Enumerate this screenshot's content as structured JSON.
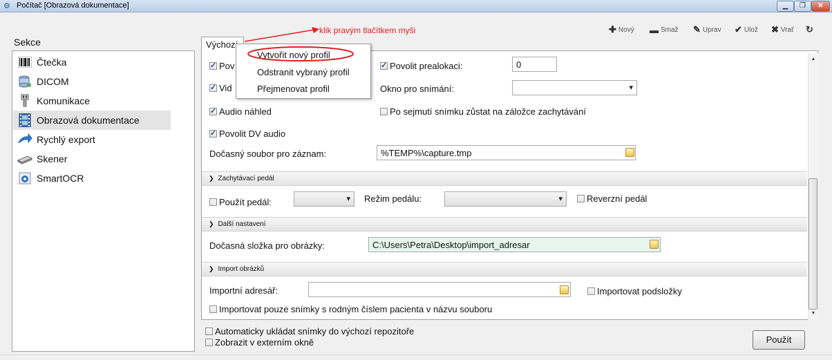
{
  "window": {
    "title": "Počítač [Obrazová dokumentace]"
  },
  "sidebar": {
    "heading": "Sekce",
    "items": [
      {
        "label": "Čtečka",
        "icon": "barcode-icon"
      },
      {
        "label": "DICOM",
        "icon": "database-icon"
      },
      {
        "label": "Komunikace",
        "icon": "connector-icon"
      },
      {
        "label": "Obrazová dokumentace",
        "icon": "film-icon",
        "selected": true
      },
      {
        "label": "Rychlý export",
        "icon": "export-arrow-icon"
      },
      {
        "label": "Skener",
        "icon": "scanner-icon"
      },
      {
        "label": "SmartOCR",
        "icon": "ocr-icon"
      }
    ]
  },
  "toolbar": {
    "new": "Nový",
    "delete": "Smaž",
    "edit": "Uprav",
    "save": "Ulož",
    "revert": "Vrať"
  },
  "tabs": {
    "active": "Výchozí"
  },
  "annotation": {
    "text": "klik pravým tlačítkem myši",
    "color": "#e02020"
  },
  "context_menu": {
    "items": [
      "Vytvořit nový profil",
      "Odstranit vybraný profil",
      "Přejmenovat profil"
    ],
    "highlighted": "Vytvořit nový profil"
  },
  "capture": {
    "row1_left": "Pov",
    "row2_left": "Vid",
    "audio_preview": "Audio náhled",
    "allow_dv_audio": "Povolit DV audio",
    "allow_prealloc": "Povolit prealokaci:",
    "prealloc_value": "0",
    "capture_window": "Okno pro snímání:",
    "stay_on_tab": "Po sejmutí snímku zůstat na záložce zachytávání",
    "temp_file_label": "Dočasný soubor pro záznam:",
    "temp_file_value": "%TEMP%\\capture.tmp"
  },
  "pedal": {
    "header": "Zachytávací pedál",
    "use_pedal": "Použít pedál:",
    "pedal_mode": "Režim pedálu:",
    "reverse_pedal": "Reverzní pedál"
  },
  "other": {
    "header": "Další nastavení",
    "temp_folder_label": "Dočasná složka pro obrázky:",
    "temp_folder_value": "C:\\Users\\Petra\\Desktop\\import_adresar",
    "temp_folder_bg": "#e6f6ee"
  },
  "import": {
    "header": "Import obrázků",
    "dir_label": "Importní adresář:",
    "dir_value": "",
    "import_subfolders": "Importovat podsložky",
    "only_with_id": "Importovat pouze snímky s rodným číslem pacienta v názvu souboru"
  },
  "bottom": {
    "autosave": "Automaticky ukládat snímky do výchozí repozitoře",
    "external_window": "Zobrazit v externím okně",
    "apply": "Použít"
  }
}
